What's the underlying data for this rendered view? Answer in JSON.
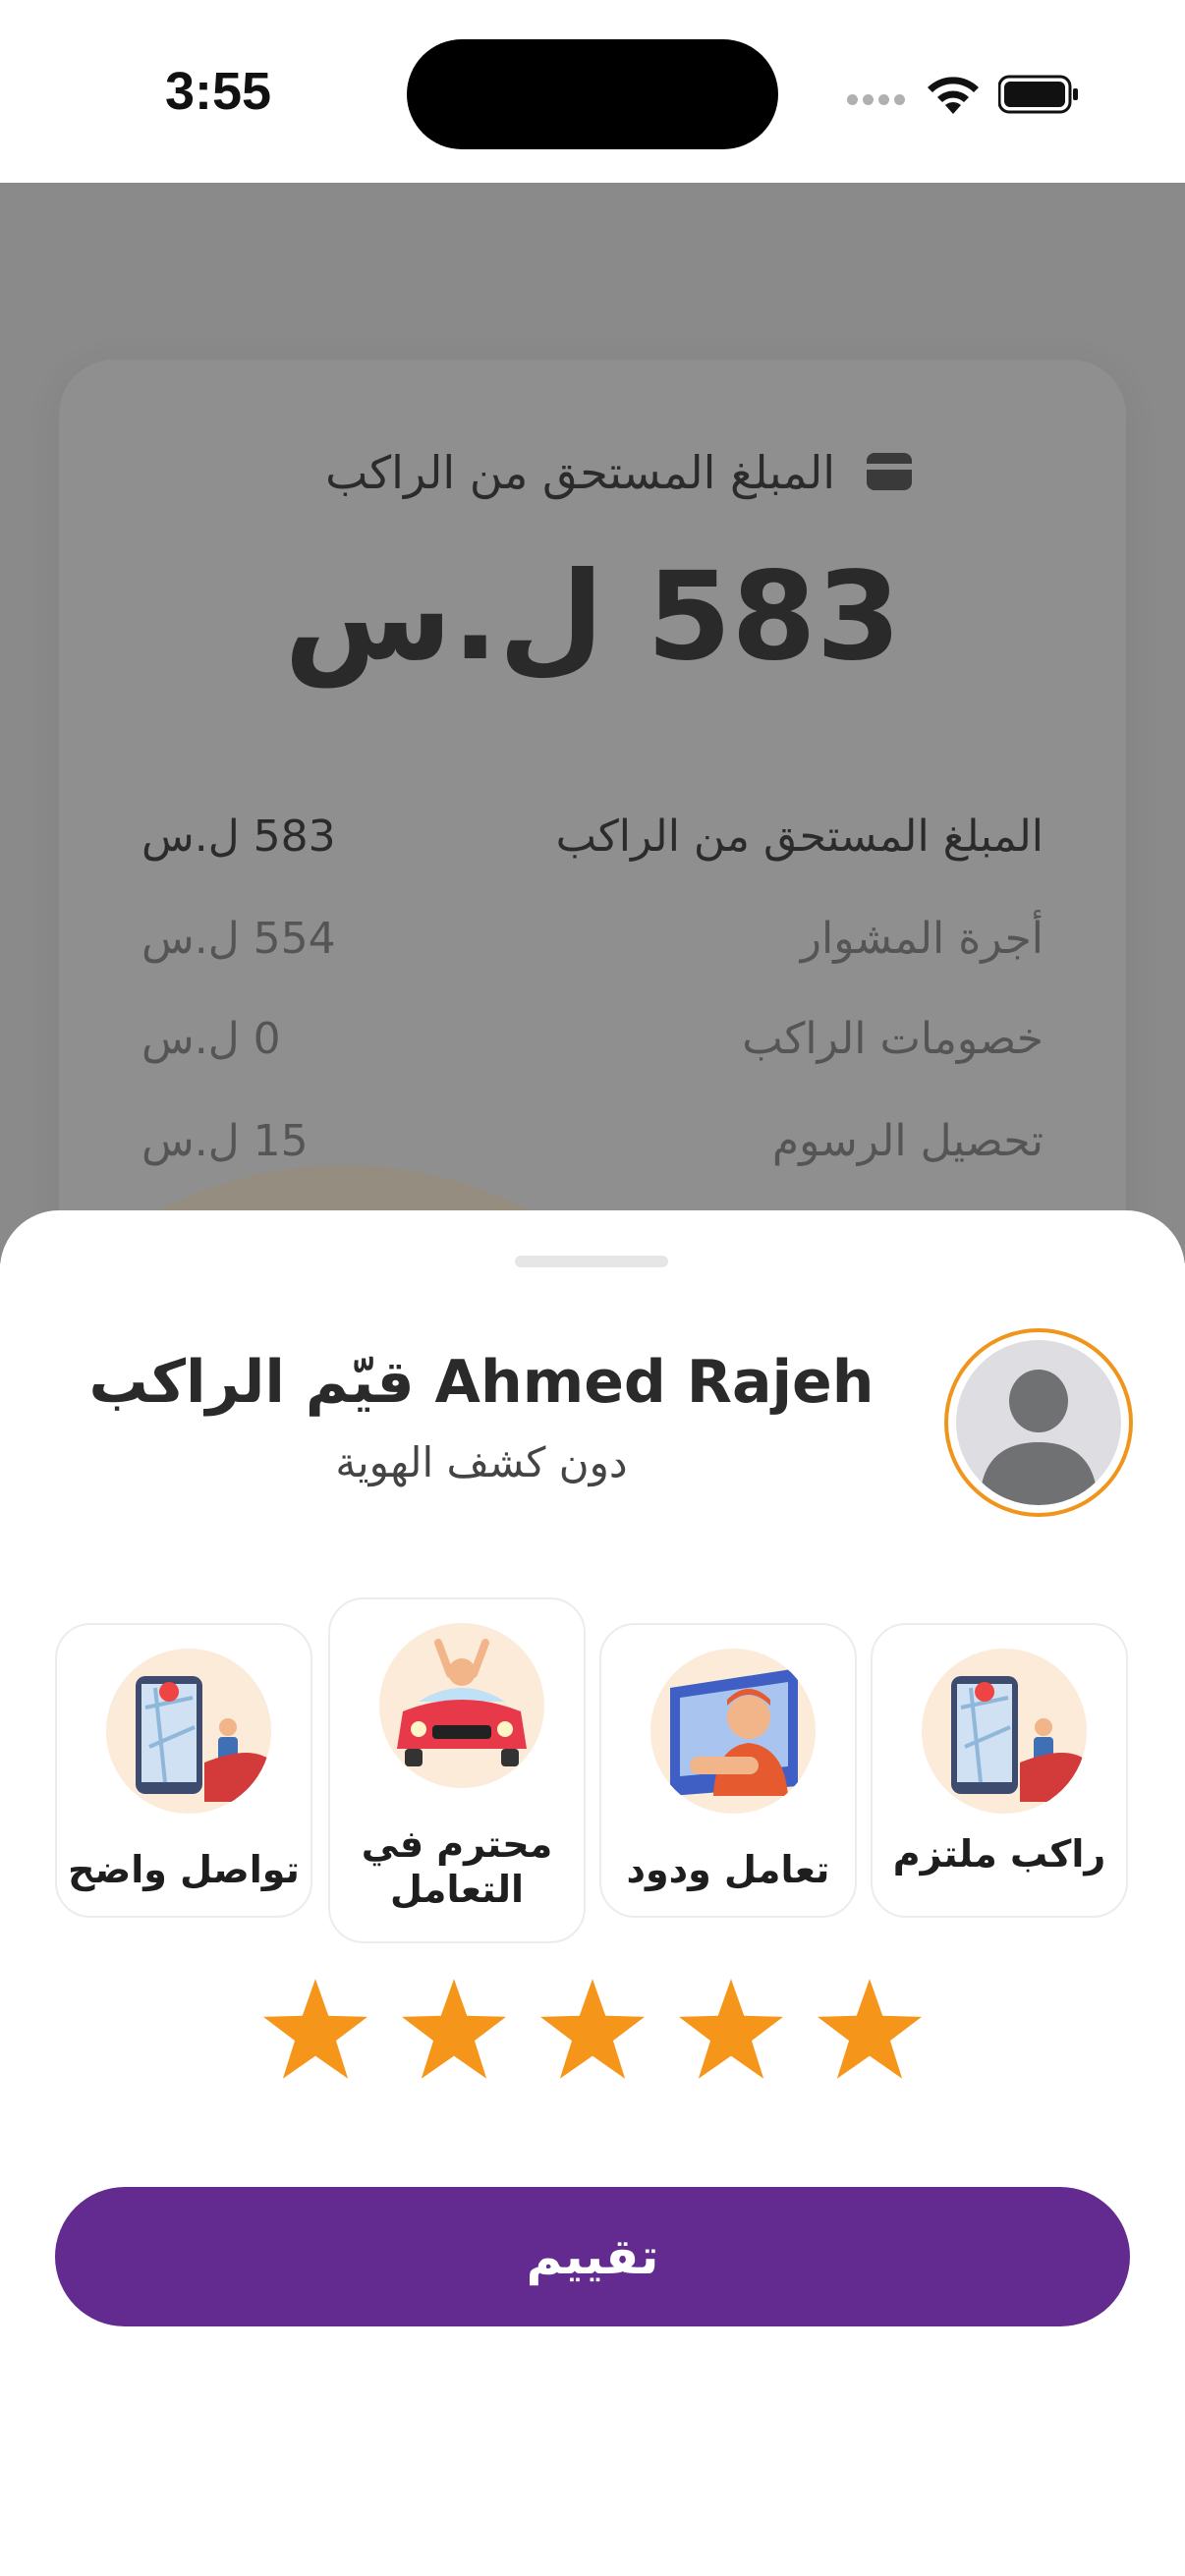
{
  "status_bar": {
    "time": "3:55"
  },
  "summary_card": {
    "heading": "المبلغ المستحق من الراكب",
    "total_amount": "583 ل.س",
    "rows": [
      {
        "label": "المبلغ المستحق من الراكب",
        "value": "583 ل.س"
      },
      {
        "label": "أجرة المشوار",
        "value": "554 ل.س"
      },
      {
        "label": "خصومات الراكب",
        "value": "0 ل.س"
      },
      {
        "label": "تحصيل الرسوم",
        "value": "15 ل.س"
      }
    ]
  },
  "rating_sheet": {
    "title": "قيّم الراكب Ahmed Rajeh",
    "subtitle": "دون كشف الهوية",
    "traits": [
      {
        "label": "راكب ملتزم",
        "icon": "map-phone-illustration"
      },
      {
        "label": "تعامل ودود",
        "icon": "friendly-driver-illustration"
      },
      {
        "label": "محترم في التعامل",
        "icon": "happy-car-illustration"
      },
      {
        "label": "تواصل واضح",
        "icon": "map-phone-illustration"
      }
    ],
    "rating": 5,
    "max_rating": 5,
    "submit_label": "تقييم"
  },
  "colors": {
    "accent_orange": "#f5961b",
    "button_purple": "#632a8f",
    "dim_overlay": "#8a8a8a"
  }
}
